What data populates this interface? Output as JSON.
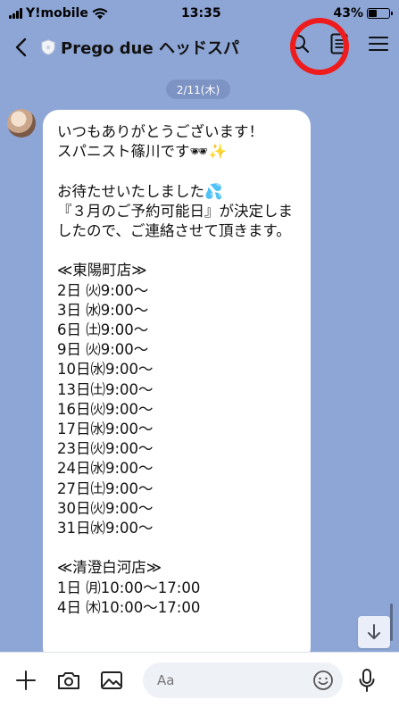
{
  "status_bar": {
    "carrier": "Y!mobile",
    "time": "13:35",
    "battery": "43%",
    "battery_level": 0.43
  },
  "header": {
    "title": "Prego due ヘッドスパ"
  },
  "chat": {
    "date": "2/11(木)",
    "message_lines": [
      "いつもありがとうございます！",
      "スパニスト篠川です🕶✨",
      "",
      "お待たせいたしました💦",
      "『３月のご予約可能日』が決定しましたので、ご連絡させて頂きます。",
      "",
      "≪東陽町店≫",
      "2日 ㈫9:00〜",
      "3日 ㈬9:00〜",
      "6日 ㈯9:00〜",
      "9日 ㈫9:00〜",
      "10日㈬9:00〜",
      "13日㈯9:00〜",
      "16日㈫9:00〜",
      "17日㈬9:00〜",
      "23日㈫9:00〜",
      "24日㈬9:00〜",
      "27日㈯9:00〜",
      "30日㈫9:00〜",
      "31日㈬9:00〜",
      "",
      "≪清澄白河店≫",
      "1日 ㈪10:00〜17:00",
      "4日 ㈭10:00〜17:00"
    ]
  },
  "input": {
    "placeholder": "Aa"
  },
  "colors": {
    "background": "#8ea6d6",
    "highlight": "#ee1c1c"
  },
  "icons": {
    "back": "chevron-left-icon",
    "search": "search-icon",
    "note": "note-icon",
    "menu": "menu-icon",
    "plus": "plus-icon",
    "camera": "camera-icon",
    "image": "image-icon",
    "emoji": "emoji-icon",
    "mic": "mic-icon",
    "scroll_down": "arrow-down-icon"
  }
}
